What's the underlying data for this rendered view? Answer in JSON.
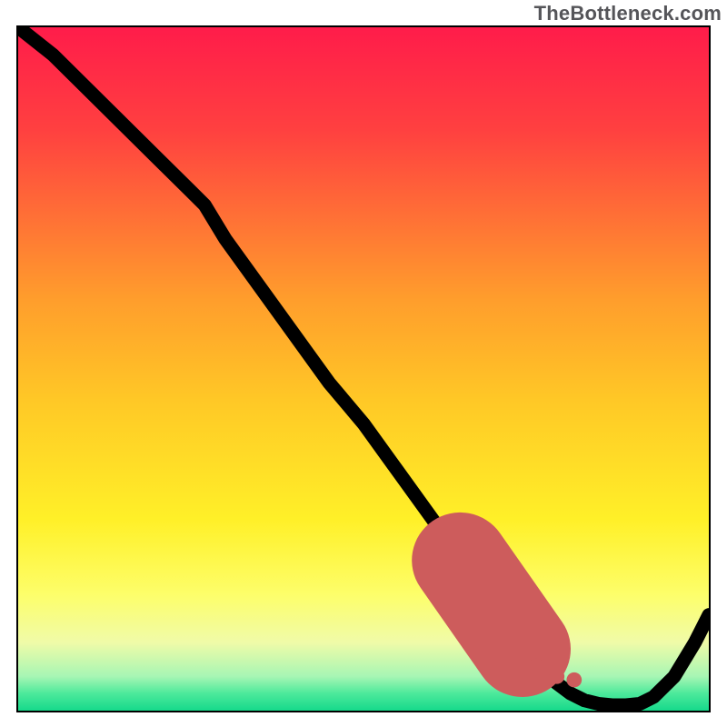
{
  "watermark": "TheBottleneck.com",
  "chart_data": {
    "type": "line",
    "title": "",
    "xlabel": "",
    "ylabel": "",
    "xlim": [
      0,
      100
    ],
    "ylim": [
      0,
      100
    ],
    "x": [
      0,
      5,
      10,
      15,
      20,
      25,
      27,
      30,
      35,
      40,
      45,
      50,
      55,
      60,
      65,
      68,
      70,
      72,
      74,
      76,
      78,
      80,
      82,
      84,
      86,
      88,
      90,
      92,
      95,
      98,
      100
    ],
    "values": [
      100,
      96,
      91,
      86,
      81,
      76,
      74,
      69,
      62,
      55,
      48,
      42,
      35,
      28,
      21,
      16,
      14,
      11,
      8,
      6,
      4,
      2.5,
      1.5,
      1,
      0.8,
      0.8,
      1,
      2,
      5,
      10,
      14
    ],
    "highlight_segment": {
      "x": [
        64,
        73
      ],
      "values": [
        22,
        9
      ]
    },
    "highlight_dots": [
      {
        "x": 75,
        "y": 6.5
      },
      {
        "x": 78,
        "y": 5
      },
      {
        "x": 80.5,
        "y": 4.5
      }
    ],
    "gradient_stops": [
      {
        "offset": 0.0,
        "color": "#FF1C4A"
      },
      {
        "offset": 0.15,
        "color": "#FF4040"
      },
      {
        "offset": 0.4,
        "color": "#FF9E2C"
      },
      {
        "offset": 0.55,
        "color": "#FFC926"
      },
      {
        "offset": 0.72,
        "color": "#FFF028"
      },
      {
        "offset": 0.83,
        "color": "#FDFE6A"
      },
      {
        "offset": 0.9,
        "color": "#F0FBA8"
      },
      {
        "offset": 0.95,
        "color": "#A7F6B4"
      },
      {
        "offset": 0.975,
        "color": "#4CE99B"
      },
      {
        "offset": 1.0,
        "color": "#16D98B"
      }
    ]
  }
}
